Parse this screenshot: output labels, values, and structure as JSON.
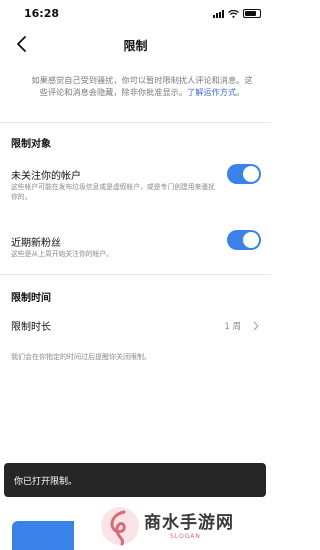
{
  "status": {
    "time": "16:28"
  },
  "nav": {
    "title": "限制"
  },
  "notice": {
    "text": "如果感觉自己受到骚扰，你可以暂时限制扰人评论和消息。这些评论和消息会隐藏，除非你批准显示。",
    "link": "了解运作方式",
    "end": "。"
  },
  "restrict_targets": {
    "title": "限制对象",
    "items": [
      {
        "label": "未关注你的帐户",
        "description": "这些帐户可能在发布垃圾信息或是虚假帐户，或是专门创建用来骚扰你的。",
        "enabled": true
      },
      {
        "label": "近期新粉丝",
        "description": "这些是从上周开始关注你的帐户。",
        "enabled": true
      }
    ]
  },
  "restrict_time": {
    "title": "限制时间",
    "label": "限制时长",
    "value": "1 周",
    "footnote": "我们会在你指定的时间过后提醒你关闭限制。"
  },
  "toast": {
    "message": "你已打开限制。"
  },
  "watermark": {
    "name": "商水手游网",
    "slogan": "SLOGAN"
  },
  "colors": {
    "accent": "#3b82e8",
    "toast_bg": "#262626",
    "watermark": "#d86a78"
  }
}
